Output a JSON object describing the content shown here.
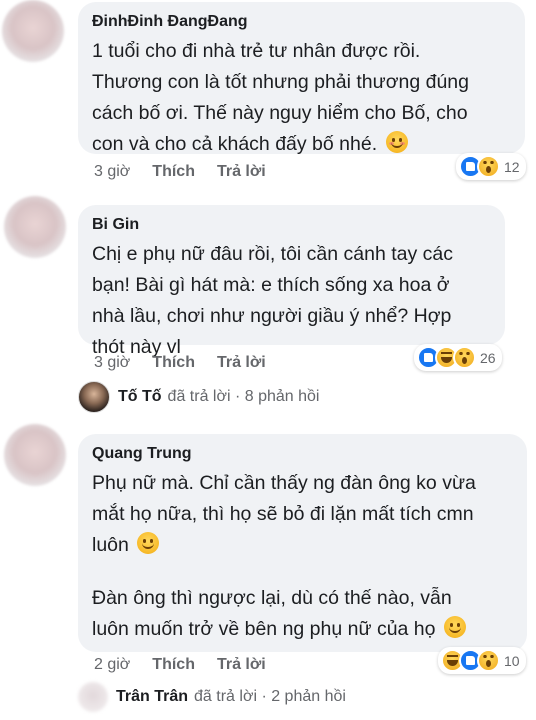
{
  "comments": [
    {
      "author": "ĐinhĐinh ĐangĐang",
      "lines": [
        "1 tuổi cho đi nhà trẻ tư nhân được rồi.",
        "Thương con là tốt nhưng phải thương đúng",
        "cách bố ơi. Thế này nguy hiểm cho Bố, cho",
        "con và cho cả khách đấy bố nhé."
      ],
      "emoji": "smiling-blush-emoji",
      "time": "3 giờ",
      "like": "Thích",
      "reply": "Trả lời",
      "reactions": [
        "like",
        "wow"
      ],
      "reaction_count": "12"
    },
    {
      "author": "Bi Gin",
      "lines": [
        "Chị e phụ nữ đâu rồi, tôi cần cánh tay các",
        "bạn! Bài gì hát mà: e thích sống xa hoa ở",
        "nhà lầu, chơi như người giầu ý nhể? Hợp",
        "thót này vl"
      ],
      "time": "3 giờ",
      "like": "Thích",
      "reply": "Trả lời",
      "reactions": [
        "like",
        "haha",
        "wow"
      ],
      "reaction_count": "26",
      "replies": {
        "name": "Tố Tố",
        "text": "đã trả lời · 8 phản hồi"
      }
    },
    {
      "author": "Quang Trung",
      "paragraph1": [
        "Phụ nữ mà. Chỉ cần thấy ng đàn ông ko vừa",
        "mắt họ nữa, thì họ sẽ bỏ đi lặn mất tích cmn",
        "luôn"
      ],
      "paragraph2": [
        "Đàn ông thì ngược lại, dù có thế nào, vẫn",
        "luôn muốn trở về bên ng phụ nữ của họ"
      ],
      "time": "2 giờ",
      "like": "Thích",
      "reply": "Trả lời",
      "reactions": [
        "haha",
        "like",
        "wow"
      ],
      "reaction_count": "10",
      "replies": {
        "name": "Trân Trân",
        "text": "đã trả lời · 2 phản hồi"
      }
    }
  ],
  "colors": {
    "bubble": "#f0f2f5",
    "meta": "#65676b",
    "like_blue": "#1877f2",
    "emoji_yellow": "#f7b928"
  }
}
